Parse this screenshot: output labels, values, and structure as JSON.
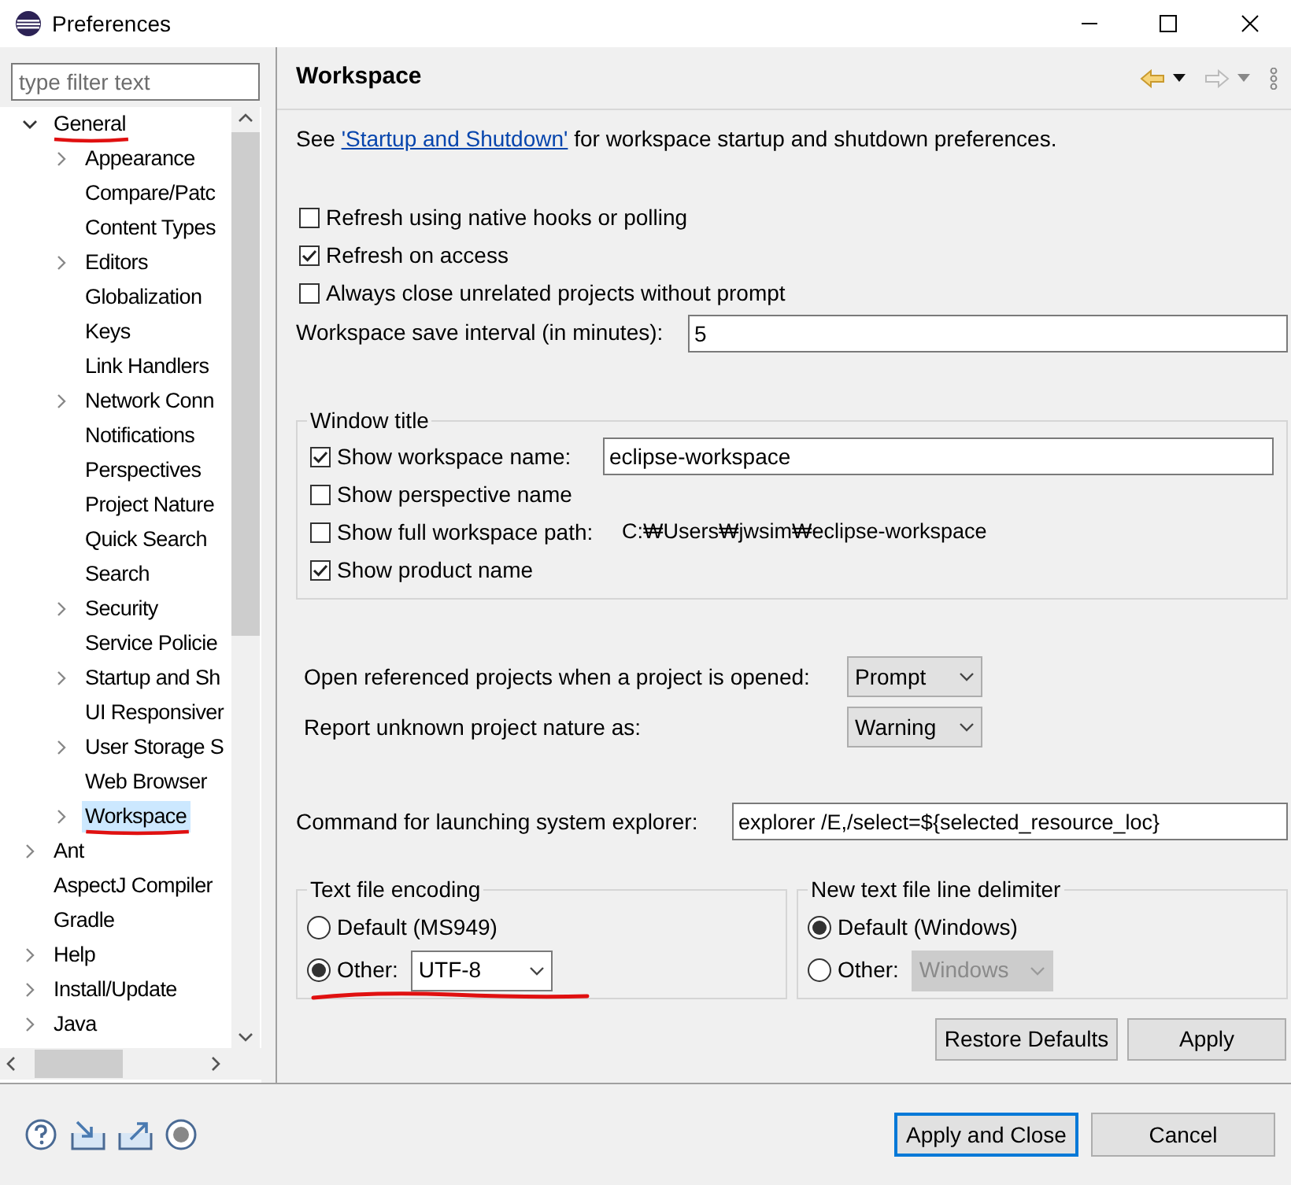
{
  "window": {
    "title": "Preferences"
  },
  "filter": {
    "placeholder": "type filter text"
  },
  "tree": [
    {
      "label": "General",
      "expandable": true,
      "expanded": true,
      "selected": false,
      "marked": true,
      "children": [
        {
          "label": "Appearance",
          "expandable": true,
          "expanded": false,
          "selected": false,
          "marked": false
        },
        {
          "label": "Compare/Patc",
          "expandable": false,
          "expanded": false,
          "selected": false,
          "marked": false
        },
        {
          "label": "Content Types",
          "expandable": false,
          "expanded": false,
          "selected": false,
          "marked": false
        },
        {
          "label": "Editors",
          "expandable": true,
          "expanded": false,
          "selected": false,
          "marked": false
        },
        {
          "label": "Globalization",
          "expandable": false,
          "expanded": false,
          "selected": false,
          "marked": false
        },
        {
          "label": "Keys",
          "expandable": false,
          "expanded": false,
          "selected": false,
          "marked": false
        },
        {
          "label": "Link Handlers",
          "expandable": false,
          "expanded": false,
          "selected": false,
          "marked": false
        },
        {
          "label": "Network Conn",
          "expandable": true,
          "expanded": false,
          "selected": false,
          "marked": false
        },
        {
          "label": "Notifications",
          "expandable": false,
          "expanded": false,
          "selected": false,
          "marked": false
        },
        {
          "label": "Perspectives",
          "expandable": false,
          "expanded": false,
          "selected": false,
          "marked": false
        },
        {
          "label": "Project Nature",
          "expandable": false,
          "expanded": false,
          "selected": false,
          "marked": false
        },
        {
          "label": "Quick Search",
          "expandable": false,
          "expanded": false,
          "selected": false,
          "marked": false
        },
        {
          "label": "Search",
          "expandable": false,
          "expanded": false,
          "selected": false,
          "marked": false
        },
        {
          "label": "Security",
          "expandable": true,
          "expanded": false,
          "selected": false,
          "marked": false
        },
        {
          "label": "Service Policie",
          "expandable": false,
          "expanded": false,
          "selected": false,
          "marked": false
        },
        {
          "label": "Startup and Sh",
          "expandable": true,
          "expanded": false,
          "selected": false,
          "marked": false
        },
        {
          "label": "UI Responsiver",
          "expandable": false,
          "expanded": false,
          "selected": false,
          "marked": false
        },
        {
          "label": "User Storage S",
          "expandable": true,
          "expanded": false,
          "selected": false,
          "marked": false
        },
        {
          "label": "Web Browser",
          "expandable": false,
          "expanded": false,
          "selected": false,
          "marked": false
        },
        {
          "label": "Workspace",
          "expandable": true,
          "expanded": false,
          "selected": true,
          "marked": true
        }
      ]
    },
    {
      "label": "Ant",
      "expandable": true,
      "expanded": false,
      "selected": false,
      "marked": false
    },
    {
      "label": "AspectJ Compiler",
      "expandable": false,
      "expanded": false,
      "selected": false,
      "marked": false
    },
    {
      "label": "Gradle",
      "expandable": false,
      "expanded": false,
      "selected": false,
      "marked": false
    },
    {
      "label": "Help",
      "expandable": true,
      "expanded": false,
      "selected": false,
      "marked": false
    },
    {
      "label": "Install/Update",
      "expandable": true,
      "expanded": false,
      "selected": false,
      "marked": false
    },
    {
      "label": "Java",
      "expandable": true,
      "expanded": false,
      "selected": false,
      "marked": false
    }
  ],
  "page": {
    "title": "Workspace",
    "intro_before": "See ",
    "intro_link": "'Startup and Shutdown'",
    "intro_after": " for workspace startup and shutdown preferences."
  },
  "checkboxes": [
    {
      "label": "Refresh using native hooks or polling",
      "checked": false
    },
    {
      "label": "Refresh on access",
      "checked": true
    },
    {
      "label": "Always close unrelated projects without prompt",
      "checked": false
    }
  ],
  "save_interval": {
    "label": "Workspace save interval (in minutes):",
    "value": "5"
  },
  "window_title": {
    "title": "Window title",
    "rows": [
      {
        "kind": "field",
        "label": "Show workspace name:",
        "checked": true,
        "value": "eclipse-workspace"
      },
      {
        "kind": "plain",
        "label": "Show perspective name",
        "checked": false
      },
      {
        "kind": "path",
        "label": "Show full workspace path:",
        "checked": false,
        "value": "C:₩Users₩jwsim₩eclipse-workspace"
      },
      {
        "kind": "plain",
        "label": "Show product name",
        "checked": true
      }
    ]
  },
  "dropdowns": [
    {
      "label": "Open referenced projects when a project is opened:",
      "value": "Prompt"
    },
    {
      "label": "Report unknown project nature as:",
      "value": "Warning"
    }
  ],
  "explorer": {
    "label": "Command for launching system explorer:",
    "value": "explorer /E,/select=${selected_resource_loc}"
  },
  "groups": [
    {
      "title": "Text file encoding",
      "marked": true,
      "options": [
        {
          "label": "Default (MS949)",
          "selected": false
        },
        {
          "label": "Other:",
          "selected": true,
          "value": "UTF-8",
          "disabled": false
        }
      ]
    },
    {
      "title": "New text file line delimiter",
      "marked": false,
      "options": [
        {
          "label": "Default (Windows)",
          "selected": true
        },
        {
          "label": "Other:",
          "selected": false,
          "value": "Windows",
          "disabled": true
        }
      ]
    }
  ],
  "page_buttons": [
    "Restore Defaults",
    "Apply"
  ],
  "footer_buttons": [
    {
      "label": "Apply and Close",
      "default": true
    },
    {
      "label": "Cancel",
      "default": false
    }
  ]
}
